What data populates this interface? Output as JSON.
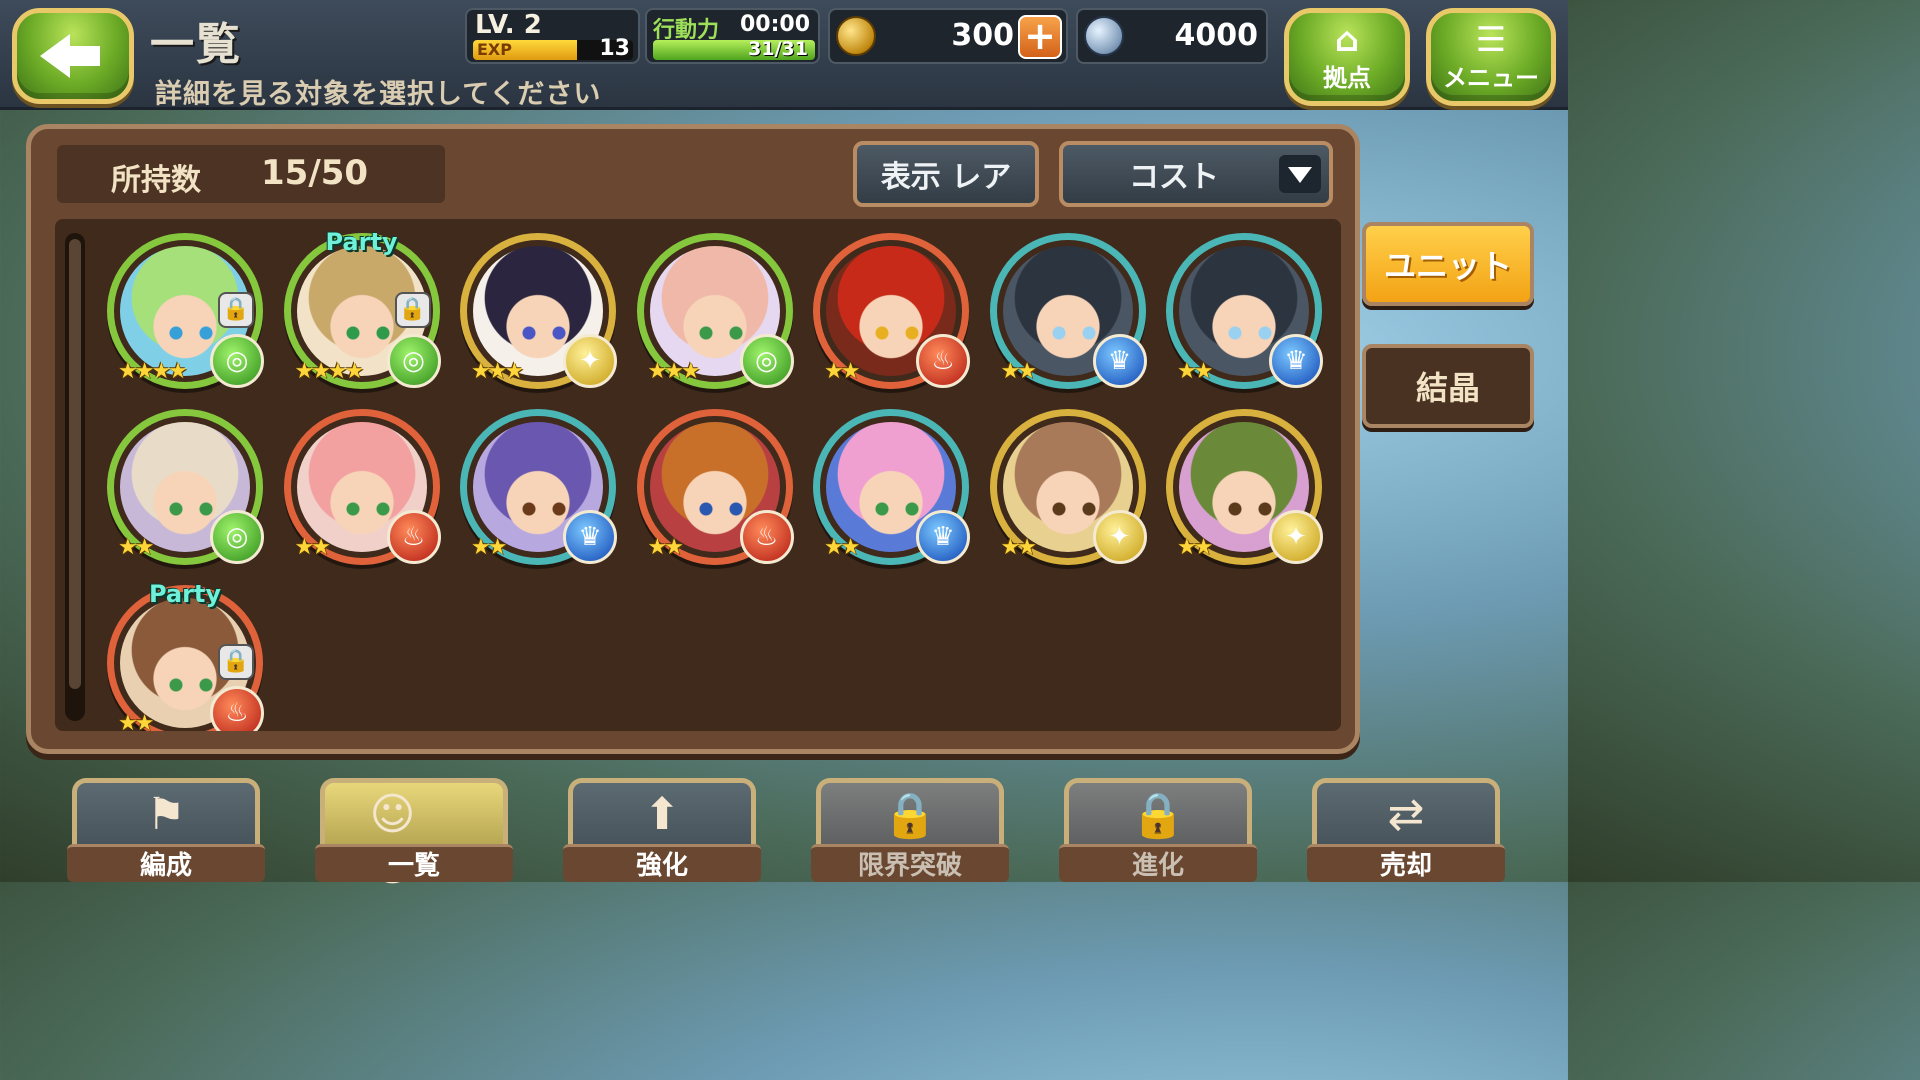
{
  "header": {
    "title": "一覧",
    "subtitle": "詳細を見る対象を選択してください",
    "level_label": "LV.",
    "level": "2",
    "exp_label": "EXP",
    "exp_value": "13",
    "exp_fraction": 0.65,
    "ap_label": "行動力",
    "ap_timer": "00:00",
    "ap_value": "31/31",
    "ap_fraction": 1.0,
    "coins": "300",
    "crystals": "4000",
    "home_label": "拠点",
    "menu_label": "メニュー"
  },
  "panel": {
    "count_label": "所持数",
    "count_value": "15/50",
    "display_button": "表示 レア",
    "sort_button": "コスト"
  },
  "units": [
    {
      "stars": "★★★★",
      "element": "wind",
      "locked": true,
      "party": false,
      "hair": "#a6e07a",
      "bg": "#7fd0e6",
      "eye": "#37a0d8",
      "ring": "green"
    },
    {
      "stars": "★★★★",
      "element": "wind",
      "locked": true,
      "party": true,
      "party_label": "Party",
      "hair": "#c9a96a",
      "bg": "#f2e3c8",
      "eye": "#2f9a4a",
      "ring": "green"
    },
    {
      "stars": "★★★",
      "element": "light",
      "locked": false,
      "party": false,
      "hair": "#2b2540",
      "bg": "#f6f0ea",
      "eye": "#4a56c4",
      "ring": "gold"
    },
    {
      "stars": "★★★",
      "element": "wind",
      "locked": false,
      "party": false,
      "hair": "#f0b8a8",
      "bg": "#e6d8f0",
      "eye": "#3a9a4a",
      "ring": "green"
    },
    {
      "stars": "★★",
      "element": "fire",
      "locked": false,
      "party": false,
      "hair": "#c82a1a",
      "bg": "#7a2a1a",
      "eye": "#e8b020",
      "ring": "red"
    },
    {
      "stars": "★★",
      "element": "water",
      "locked": false,
      "party": false,
      "hair": "#2c3440",
      "bg": "#4a5664",
      "eye": "#9ad0f0",
      "ring": "teal"
    },
    {
      "stars": "★★",
      "element": "water",
      "locked": false,
      "party": false,
      "hair": "#2c3440",
      "bg": "#4a5664",
      "eye": "#9ad0f0",
      "ring": "teal"
    },
    {
      "stars": "★★",
      "element": "wind",
      "locked": false,
      "party": false,
      "hair": "#e8dcc8",
      "bg": "#c8b8d8",
      "eye": "#3a9a4a",
      "ring": "green"
    },
    {
      "stars": "★★",
      "element": "fire",
      "locked": false,
      "party": false,
      "hair": "#f2a0a0",
      "bg": "#f0d0c8",
      "eye": "#3a9a4a",
      "ring": "red"
    },
    {
      "stars": "★★",
      "element": "water",
      "locked": false,
      "party": false,
      "hair": "#6a58b0",
      "bg": "#b8a8e0",
      "eye": "#6a3a1a",
      "ring": "teal"
    },
    {
      "stars": "★★",
      "element": "fire",
      "locked": false,
      "party": false,
      "hair": "#c8702a",
      "bg": "#b84040",
      "eye": "#2a58b0",
      "ring": "red"
    },
    {
      "stars": "★★",
      "element": "water",
      "locked": false,
      "party": false,
      "hair": "#f0a0d0",
      "bg": "#5a7ad8",
      "eye": "#3a9a4a",
      "ring": "teal"
    },
    {
      "stars": "★★",
      "element": "light",
      "locked": false,
      "party": false,
      "hair": "#a87a5a",
      "bg": "#e8d090",
      "eye": "#5a3a1a",
      "ring": "gold"
    },
    {
      "stars": "★★",
      "element": "light",
      "locked": false,
      "party": false,
      "hair": "#6a8a3a",
      "bg": "#d8a0d0",
      "eye": "#5a3a1a",
      "ring": "gold"
    },
    {
      "stars": "★★",
      "element": "fire",
      "locked": true,
      "party": true,
      "party_label": "Party",
      "hair": "#8a5a3a",
      "bg": "#e8d0b0",
      "eye": "#3a9a4a",
      "ring": "red"
    }
  ],
  "side_tabs": {
    "unit": "ユニット",
    "crystal": "結晶"
  },
  "bottom_nav": [
    {
      "label": "編成",
      "icon": "flag-icon",
      "state": "normal"
    },
    {
      "label": "一覧",
      "icon": "group-icon",
      "state": "active"
    },
    {
      "label": "強化",
      "icon": "power-up-icon",
      "state": "normal"
    },
    {
      "label": "限界突破",
      "icon": "lock-icon",
      "state": "locked"
    },
    {
      "label": "進化",
      "icon": "lock-icon",
      "state": "locked"
    },
    {
      "label": "売却",
      "icon": "sell-icon",
      "state": "normal"
    }
  ],
  "element_glyphs": {
    "wind": "◎",
    "fire": "♨",
    "water": "♛",
    "light": "✦"
  },
  "colors": {
    "accent": "#f3a214",
    "panel": "#6a4730",
    "green_button": "#6cab26"
  }
}
